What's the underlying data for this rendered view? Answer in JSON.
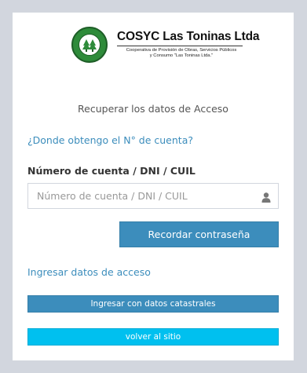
{
  "logo": {
    "name": "COSYC Las Toninas Ltda",
    "subtitle_line1": "Cooperativa de Provisión de Obras, Servicios Públicos",
    "subtitle_line2": "y Consumo \"Las Toninas Ltda.\""
  },
  "form": {
    "subtitle": "Recuperar los datos de Acceso",
    "help_link": "¿Donde obtengo el N° de cuenta?",
    "field_label": "Número de cuenta / DNI / CUIL",
    "field_placeholder": "Número de cuenta / DNI / CUIL",
    "field_value": "",
    "submit_label": "Recordar contraseña",
    "login_link": "Ingresar datos de acceso",
    "catastral_button": "Ingresar con datos catastrales",
    "back_button": "volver al sitio"
  },
  "icons": {
    "logo": "cosyc-logo-icon",
    "field": "user-icon"
  },
  "colors": {
    "primary": "#3c8dbc",
    "info": "#00c0ef",
    "background": "#d2d6de",
    "logo_green": "#2e8b3a"
  }
}
